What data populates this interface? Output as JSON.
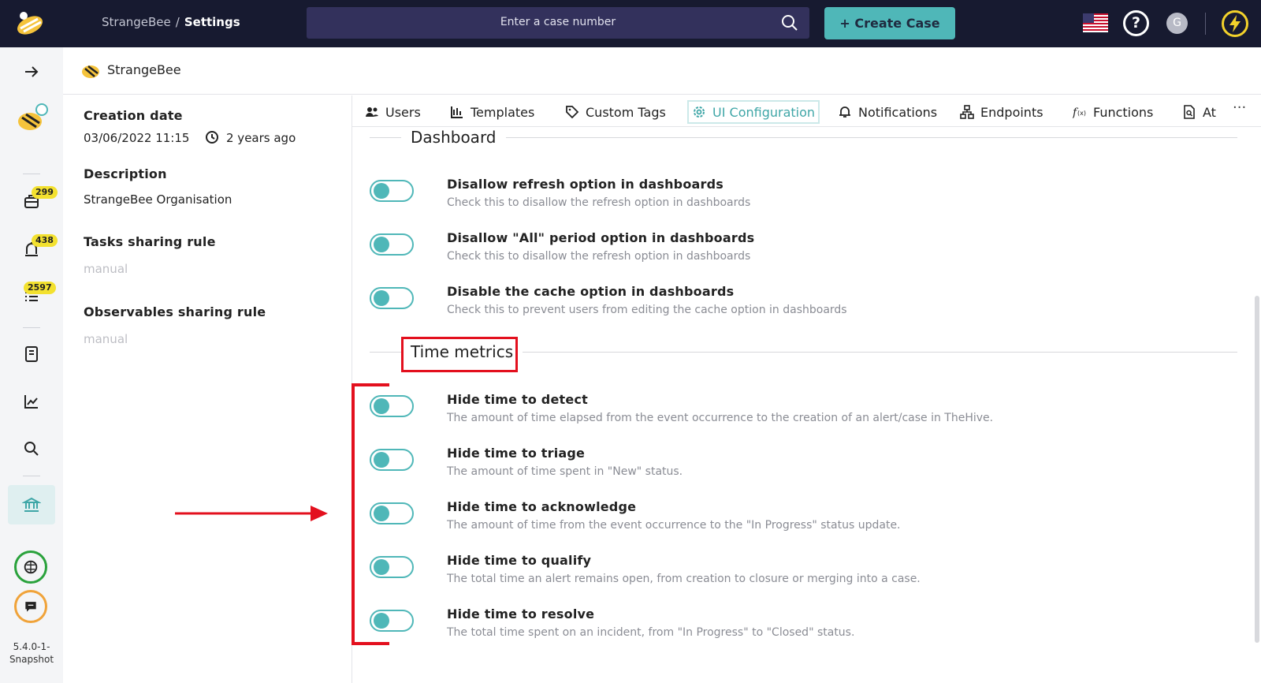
{
  "topbar": {
    "breadcrumb_parent": "StrangeBee",
    "breadcrumb_separator": "/",
    "breadcrumb_current": "Settings",
    "search_placeholder": "Enter a case number",
    "create_case_label": "+ Create Case",
    "avatar_initial": "G",
    "help_label": "?"
  },
  "sidebar": {
    "badges": {
      "cases": "299",
      "alerts": "438",
      "tasks": "2597"
    },
    "version": "5.4.0-1-Snapshot"
  },
  "org": {
    "name": "StrangeBee"
  },
  "info": {
    "creation_label": "Creation date",
    "creation_value": "03/06/2022 11:15",
    "creation_relative": "2 years ago",
    "description_label": "Description",
    "description_value": "StrangeBee Organisation",
    "tasks_rule_label": "Tasks sharing rule",
    "tasks_rule_value": "manual",
    "observables_rule_label": "Observables sharing rule",
    "observables_rule_value": "manual"
  },
  "tabs": [
    "Users",
    "Templates",
    "Custom Tags",
    "UI Configuration",
    "Notifications",
    "Endpoints",
    "Functions",
    "At"
  ],
  "more_label": "···",
  "dashboard": {
    "title": "Dashboard",
    "options": [
      {
        "title": "Disallow refresh option in dashboards",
        "desc": "Check this to disallow the refresh option in dashboards"
      },
      {
        "title": "Disallow \"All\" period option in dashboards",
        "desc": "Check this to disallow the refresh option in dashboards"
      },
      {
        "title": "Disable the cache option in dashboards",
        "desc": "Check this to prevent users from editing the cache option in dashboards"
      }
    ]
  },
  "time_metrics": {
    "title": "Time metrics",
    "options": [
      {
        "title": "Hide time to detect",
        "desc": "The amount of time elapsed from the event occurrence to the creation of an alert/case in TheHive."
      },
      {
        "title": "Hide time to triage",
        "desc": "The amount of time spent in \"New\" status."
      },
      {
        "title": "Hide time to acknowledge",
        "desc": "The amount of time from the event occurrence to the \"In Progress\" status update."
      },
      {
        "title": "Hide time to qualify",
        "desc": "The total time an alert remains open, from creation to closure or merging into a case."
      },
      {
        "title": "Hide time to resolve",
        "desc": "The total time spent on an incident, from \"In Progress\" to \"Closed\" status."
      }
    ]
  },
  "colors": {
    "accent": "#4fb7b8",
    "topbar": "#171a30",
    "annotation": "#e3101e",
    "badge": "#f3e12f"
  }
}
